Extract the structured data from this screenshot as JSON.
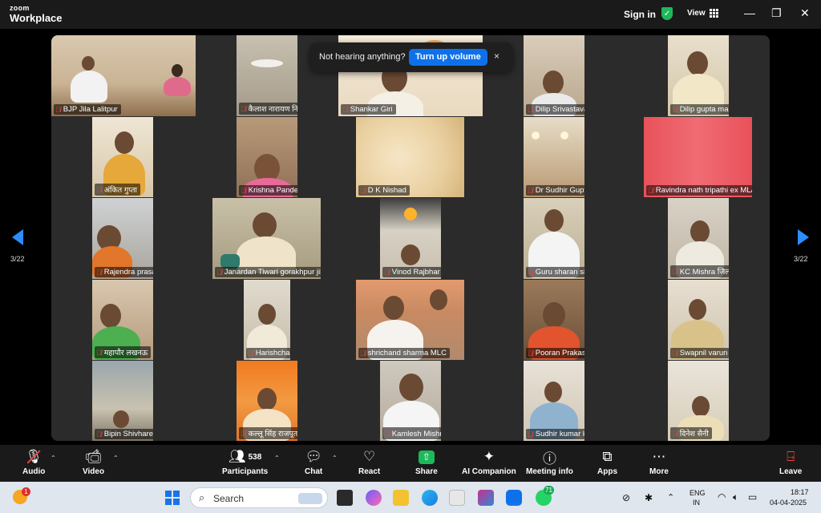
{
  "app": {
    "logo_line1": "zoom",
    "logo_line2": "Workplace",
    "signin": "Sign in",
    "view": "View"
  },
  "toast": {
    "message": "Not hearing anything?",
    "button": "Turn up volume",
    "close": "×"
  },
  "pagination": {
    "left": "3/22",
    "right": "3/22"
  },
  "participants": [
    {
      "name": "BJP Jila Lalitpur"
    },
    {
      "name": "कैलाश नारायण निरंजन अध्यक्ष जिला पं..."
    },
    {
      "name": "Shankar Giri"
    },
    {
      "name": "Dilip Srivastava"
    },
    {
      "name": "Dilip gupta mandal parohari chau..."
    },
    {
      "name": "अंकित गुप्ता"
    },
    {
      "name": "Krishna Pandey jila mantri Ballia B..."
    },
    {
      "name": "D K Nishad"
    },
    {
      "name": "Dr Sudhir Gupta MLC,Pilibhit/sha..."
    },
    {
      "name": "Ravindra nath tripathi  ex MLA"
    },
    {
      "name": "Rajendra prasad srivastava"
    },
    {
      "name": "Janardan Tiwari gorakhpur jila"
    },
    {
      "name": "Vinod Rajbhar jilaadhyaksh lalganj"
    },
    {
      "name": "Guru sharan singh lodhi jila maha..."
    },
    {
      "name": "KC Mishra जिलाअध्यक्ष शाहजहांपुर बी..."
    },
    {
      "name": "महापौर लखनऊ"
    },
    {
      "name": "Harishchandra Rawat Jiladhyaksh ..."
    },
    {
      "name": "shrichand sharma MLC"
    },
    {
      "name": "Pooran Prakash"
    },
    {
      "name": "Swapnil varun"
    },
    {
      "name": "Bipin Shivhare"
    },
    {
      "name": "कल्लू सिंह राजपूत"
    },
    {
      "name": "Kamlesh Mishra,क्षेत्रीय अध्यक्ष, भाजपा..."
    },
    {
      "name": "Sudhir kumar khatik"
    },
    {
      "name": "दिनेश सैनी"
    }
  ],
  "toolbar": {
    "audio": "Audio",
    "video": "Video",
    "participants": "Participants",
    "participant_count": "538",
    "chat": "Chat",
    "react": "React",
    "share": "Share",
    "ai_companion": "AI Companion",
    "meeting_info": "Meeting info",
    "apps": "Apps",
    "more": "More",
    "leave": "Leave"
  },
  "taskbar": {
    "search_placeholder": "Search",
    "notification_badge": "1",
    "whatsapp_badge": "71",
    "lang1": "ENG",
    "lang2": "IN",
    "time": "18:17",
    "date": "04-04-2025"
  },
  "colors": {
    "accent": "#0e71eb",
    "share_green": "#1eb85a",
    "mute_red": "#e8463a",
    "leave_red": "#e8463a"
  }
}
